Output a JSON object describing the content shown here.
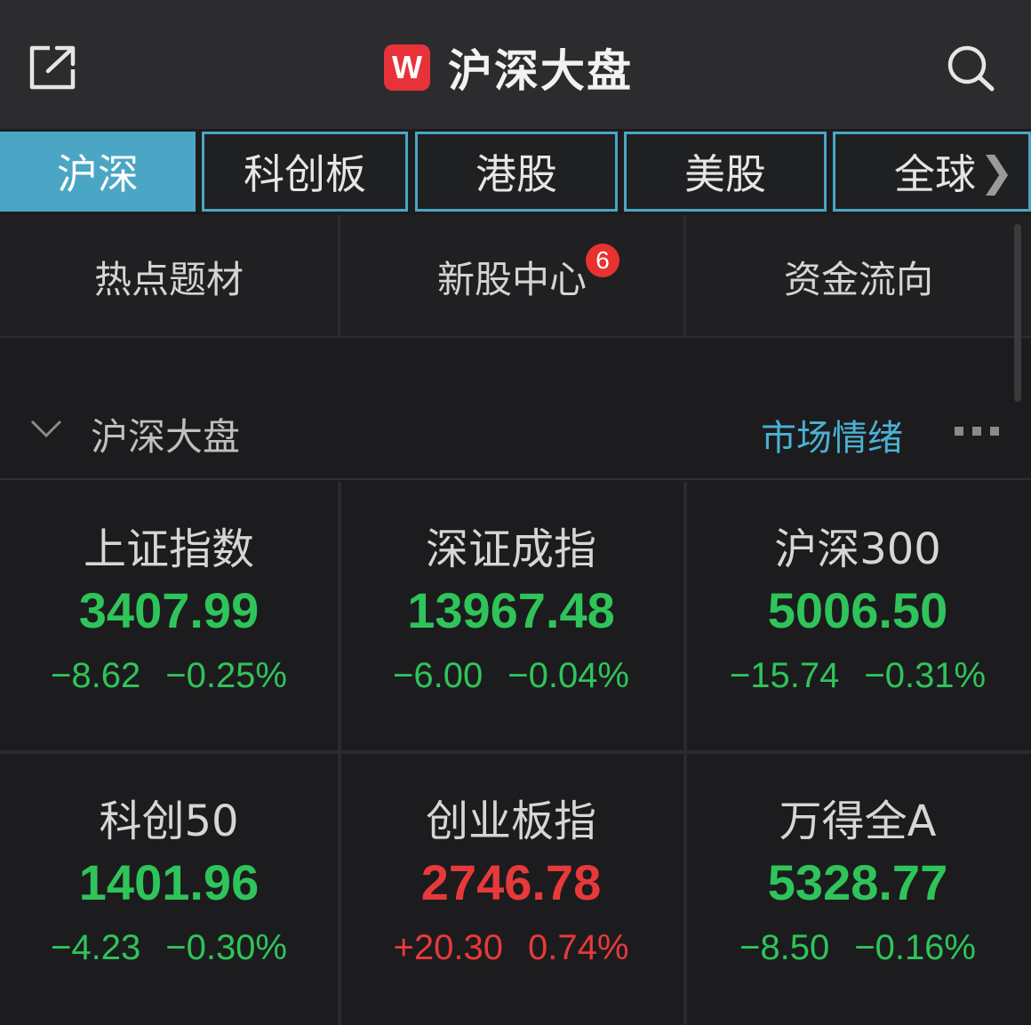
{
  "header": {
    "logo_letter": "W",
    "title": "沪深大盘",
    "share_icon": "share-icon",
    "search_icon": "search-icon"
  },
  "tabs": [
    {
      "label": "沪深",
      "active": true
    },
    {
      "label": "科创板",
      "active": false
    },
    {
      "label": "港股",
      "active": false
    },
    {
      "label": "美股",
      "active": false
    },
    {
      "label": "全球",
      "active": false
    }
  ],
  "shortcuts": [
    {
      "label": "热点题材"
    },
    {
      "label": "新股中心",
      "badge": "6"
    },
    {
      "label": "资金流向"
    }
  ],
  "section": {
    "title": "沪深大盘",
    "link": "市场情绪"
  },
  "indices": [
    {
      "name": "上证指数",
      "price": "3407.99",
      "change": "−8.62",
      "pct": "−0.25%",
      "trend": "down"
    },
    {
      "name": "深证成指",
      "price": "13967.48",
      "change": "−6.00",
      "pct": "−0.04%",
      "trend": "down"
    },
    {
      "name": "沪深300",
      "price": "5006.50",
      "change": "−15.74",
      "pct": "−0.31%",
      "trend": "down"
    },
    {
      "name": "科创50",
      "price": "1401.96",
      "change": "−4.23",
      "pct": "−0.30%",
      "trend": "down"
    },
    {
      "name": "创业板指",
      "price": "2746.78",
      "change": "+20.30",
      "pct": "0.74%",
      "trend": "up"
    },
    {
      "name": "万得全A",
      "price": "5328.77",
      "change": "−8.50",
      "pct": "−0.16%",
      "trend": "down"
    }
  ],
  "colors": {
    "accent": "#4aa6c4",
    "up": "#e8393a",
    "down": "#2fc45a",
    "badge": "#e8322f"
  }
}
